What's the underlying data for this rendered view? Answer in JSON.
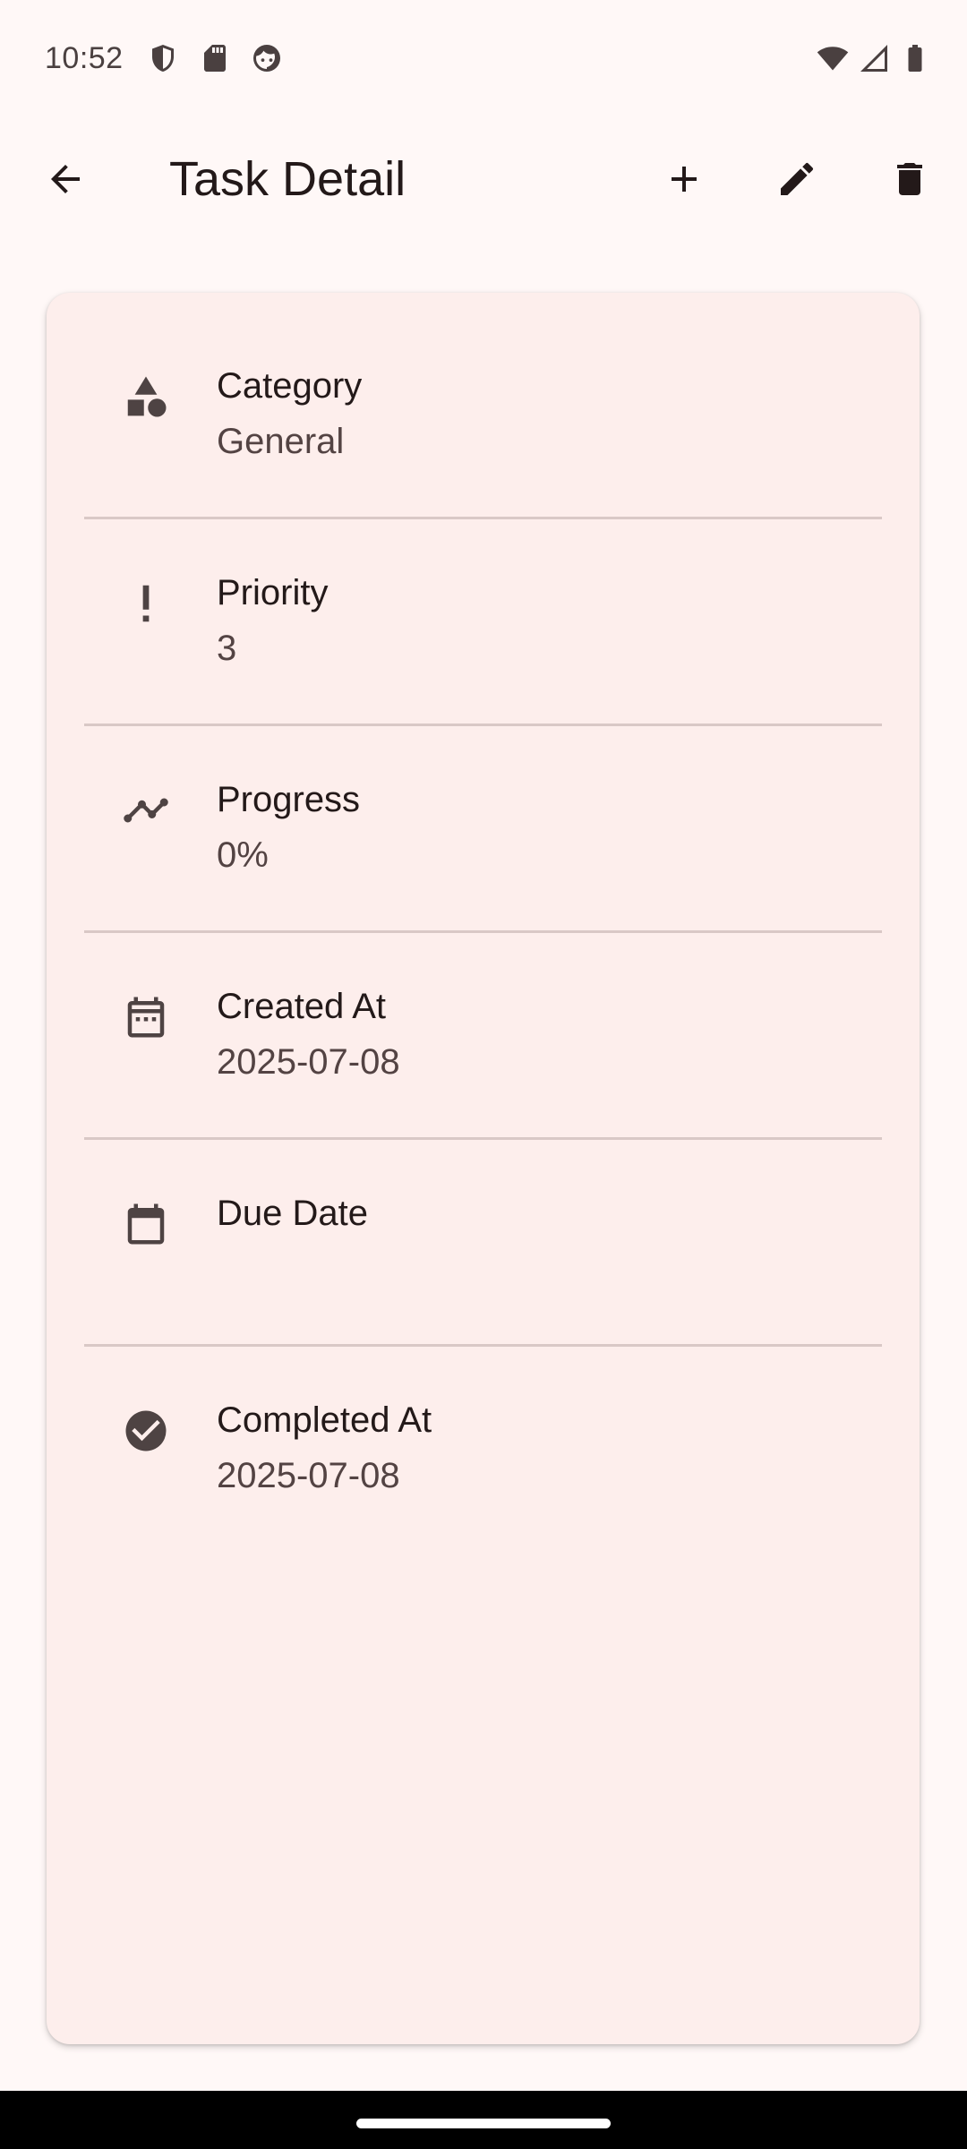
{
  "status_bar": {
    "time": "10:52",
    "left_icons": [
      "shield-icon",
      "sd-card-icon",
      "face-icon"
    ],
    "right_icons": [
      "wifi-icon",
      "signal-icon",
      "battery-icon"
    ]
  },
  "app_bar": {
    "title": "Task Detail",
    "back_icon": "arrow-back-icon",
    "actions": [
      "add-icon",
      "edit-icon",
      "delete-icon"
    ]
  },
  "details": {
    "rows": [
      {
        "label": "Category",
        "value": "General",
        "icon": "category-icon"
      },
      {
        "label": "Priority",
        "value": "3",
        "icon": "priority-icon"
      },
      {
        "label": "Progress",
        "value": "0%",
        "icon": "progress-trend-icon"
      },
      {
        "label": "Created At",
        "value": "2025-07-08",
        "icon": "calendar-event-icon"
      },
      {
        "label": "Due Date",
        "value": "",
        "icon": "calendar-icon"
      },
      {
        "label": "Completed At",
        "value": "2025-07-08",
        "icon": "check-circle-icon"
      }
    ]
  },
  "colors": {
    "background": "#fff8f7",
    "card": "#fdeeec",
    "text_primary": "#231919",
    "text_secondary": "#534343",
    "divider": "#d9c8c6"
  }
}
